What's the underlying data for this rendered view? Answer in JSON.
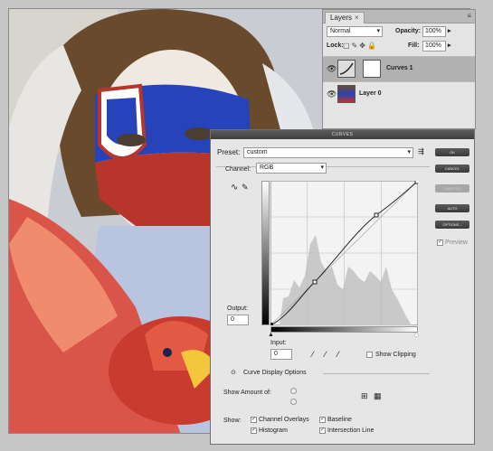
{
  "layers_panel": {
    "tab_label": "Layers",
    "tab_close": "×",
    "menu_glyph": "≡",
    "blend_mode": "Normal",
    "opacity_label": "Opacity:",
    "opacity_value": "100%",
    "lock_label": "Lock:",
    "fill_label": "Fill:",
    "fill_value": "100%",
    "layers": [
      {
        "name": "Curves 1",
        "selected": true
      },
      {
        "name": "Layer 0",
        "selected": false
      }
    ]
  },
  "curves_dialog": {
    "title": "CURVES",
    "preset_label": "Preset:",
    "preset_value": "custom",
    "channel_label": "Channel:",
    "channel_value": "RGB",
    "output_label": "Output:",
    "output_value": "0",
    "input_label": "Input:",
    "input_value": "0",
    "show_clipping_label": "Show Clipping",
    "curve_display_options_label": "Curve Display Options",
    "show_amount_label": "Show Amount of:",
    "show_label": "Show:",
    "checkboxes": {
      "channel_overlays": "Channel Overlays",
      "baseline": "Baseline",
      "histogram": "Histogram",
      "intersection_line": "Intersection Line"
    },
    "buttons": {
      "ok": "OK",
      "cancel": "CANCEL",
      "smooth": "SMOOTH",
      "auto": "AUTO",
      "options": "OPTIONS..."
    },
    "preview_label": "Preview",
    "curve_points_percent": [
      [
        0,
        0
      ],
      [
        30,
        30
      ],
      [
        72,
        76
      ],
      [
        100,
        100
      ]
    ]
  },
  "colors": {
    "panel_bg": "#e4e4e4",
    "dialog_bg": "#e6e6e6",
    "button_dark": "#4a4a4a",
    "selected_layer": "#b1b1b1"
  }
}
